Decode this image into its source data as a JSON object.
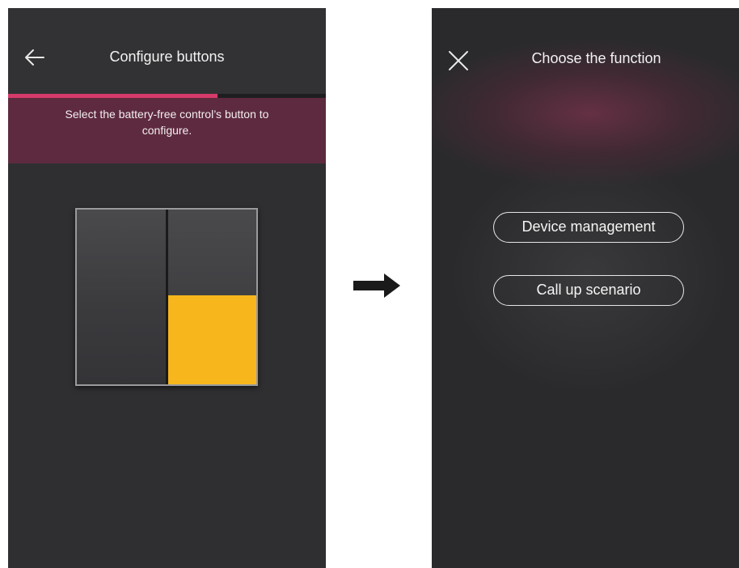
{
  "left_screen": {
    "title": "Configure buttons",
    "back_icon": "arrow-left-icon",
    "progress": 0.66,
    "accent_color": "#d63a6a",
    "instruction": "Select the battery-free control’s button to configure.",
    "selected_button_color": "#f7b61b"
  },
  "transition_icon": "arrow-right-icon",
  "right_screen": {
    "title": "Choose the function",
    "close_icon": "close-icon",
    "options": [
      {
        "label": "Device management"
      },
      {
        "label": "Call up scenario"
      }
    ]
  }
}
